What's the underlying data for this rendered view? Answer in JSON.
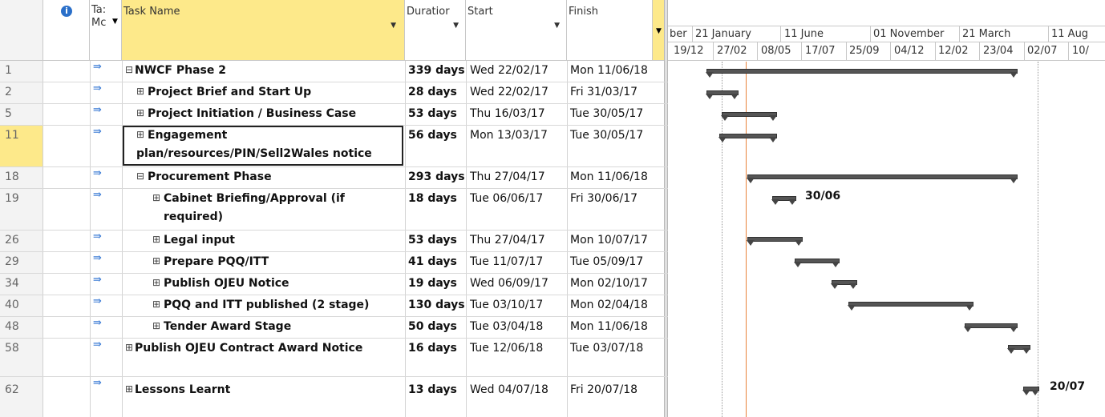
{
  "headers": {
    "task_mode": "Ta: M‹▾",
    "task_mode_top": "Ta:",
    "task_mode_bottom": "Mc",
    "task_name": "Task Name",
    "duration": "Duratior",
    "start": "Start",
    "finish": "Finish",
    "info_icon": "i"
  },
  "timescale": {
    "top": [
      "ber",
      "21 January",
      "11 June",
      "01 November",
      "21 March",
      "11 Aug"
    ],
    "bottom": [
      "19/12",
      "27/02",
      "08/05",
      "17/07",
      "25/09",
      "04/12",
      "12/02",
      "23/04",
      "02/07",
      "10/"
    ]
  },
  "rows": [
    {
      "id": "1",
      "name": "NWCF Phase 2",
      "expander": "⊟",
      "duration": "339 days",
      "start": "Wed 22/02/17",
      "finish": "Mon 11/06/18"
    },
    {
      "id": "2",
      "name": "Project Brief and Start Up",
      "expander": "⊞",
      "duration": "28 days",
      "start": "Wed 22/02/17",
      "finish": "Fri 31/03/17"
    },
    {
      "id": "5",
      "name": "Project Initiation / Business Case",
      "expander": "⊞",
      "duration": "53 days",
      "start": "Thu 16/03/17",
      "finish": "Tue 30/05/17"
    },
    {
      "id": "11",
      "name": "Engagement",
      "name2": "plan/resources/PIN/Sell2Wales notice",
      "expander": "⊞",
      "duration": "56 days",
      "start": "Mon 13/03/17",
      "finish": "Tue 30/05/17"
    },
    {
      "id": "18",
      "name": "Procurement Phase",
      "expander": "⊟",
      "duration": "293 days",
      "start": "Thu 27/04/17",
      "finish": "Mon 11/06/18"
    },
    {
      "id": "19",
      "name": "Cabinet Briefing/Approval (if",
      "name2": "required)",
      "expander": "⊞",
      "duration": "18 days",
      "start": "Tue 06/06/17",
      "finish": "Fri 30/06/17"
    },
    {
      "id": "26",
      "name": "Legal input",
      "expander": "⊞",
      "duration": "53 days",
      "start": "Thu 27/04/17",
      "finish": "Mon 10/07/17"
    },
    {
      "id": "29",
      "name": "Prepare PQQ/ITT",
      "expander": "⊞",
      "duration": "41 days",
      "start": "Tue 11/07/17",
      "finish": "Tue 05/09/17"
    },
    {
      "id": "34",
      "name": "Publish OJEU Notice",
      "expander": "⊞",
      "duration": "19 days",
      "start": "Wed 06/09/17",
      "finish": "Mon 02/10/17"
    },
    {
      "id": "40",
      "name": "PQQ and ITT published (2 stage)",
      "expander": "⊞",
      "duration": "130 days",
      "start": "Tue 03/10/17",
      "finish": "Mon 02/04/18"
    },
    {
      "id": "48",
      "name": "Tender Award Stage",
      "expander": "⊞",
      "duration": "50 days",
      "start": "Tue 03/04/18",
      "finish": "Mon 11/06/18"
    },
    {
      "id": "58",
      "name": "Publish OJEU Contract Award Notice",
      "expander": "⊞",
      "duration": "16 days",
      "start": "Tue 12/06/18",
      "finish": "Tue 03/07/18"
    },
    {
      "id": "62",
      "name": "Lessons Learnt",
      "expander": "⊞",
      "duration": "13 days",
      "start": "Wed 04/07/18",
      "finish": "Fri 20/07/18"
    }
  ],
  "bar_labels": {
    "r19": "30/06",
    "r62": "20/07"
  },
  "colors": {
    "selected_header": "#fde98a",
    "today_line": "#e8833a",
    "bar": "#555555"
  }
}
